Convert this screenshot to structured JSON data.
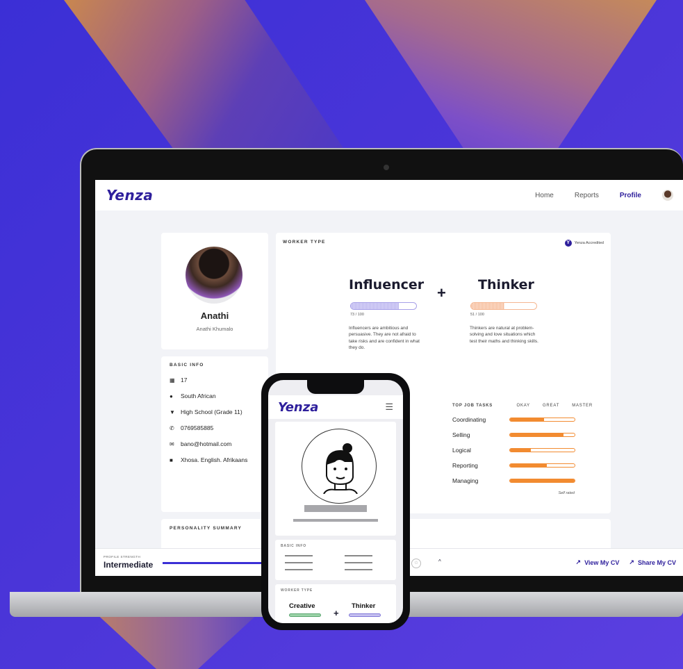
{
  "desktop": {
    "nav": {
      "logo": "Yenza",
      "links": [
        "Home",
        "Reports",
        "Profile"
      ]
    },
    "profile": {
      "name": "Anathi",
      "full_name": "Anathi Khumalo"
    },
    "basic_info": {
      "label": "BASIC INFO",
      "age": "17",
      "nationality": "South African",
      "education": "High School (Grade 11)",
      "phone": "0769585885",
      "email": "bano@hotmail.com",
      "languages": "Xhosa. English. Afrikaans"
    },
    "worker_type": {
      "label": "WORKER TYPE",
      "accredited": "Yenza Accredited",
      "primary": {
        "title": "Influencer",
        "score": "73 / 100",
        "score_value": 73,
        "description": "Influencers are ambitious and persuasive. They are not afraid to take risks and are confident in what they do."
      },
      "secondary": {
        "title": "Thinker",
        "score": "51 / 100",
        "score_value": 51,
        "description": "Thinkers are natural at problem-solving and love situations which test their maths and thinking skills."
      },
      "plus": "+"
    },
    "top_job_tasks": {
      "label": "TOP JOB TASKS",
      "levels": [
        "OKAY",
        "GREAT",
        "MASTER"
      ],
      "tasks": [
        {
          "name": "Coordinating",
          "level": 0.53
        },
        {
          "name": "Selling",
          "level": 0.83
        },
        {
          "name": "Logical",
          "level": 0.32
        },
        {
          "name": "Reporting",
          "level": 0.57
        },
        {
          "name": "Managing",
          "level": 1.0
        }
      ],
      "note": "Self rated"
    },
    "personality": {
      "label": "PERSONALITY SUMMARY"
    },
    "bottom_bar": {
      "strength_label": "PROFILE STRENGTH",
      "strength_value": "Intermediate",
      "view_cv": "View My CV",
      "share_cv": "Share My CV"
    }
  },
  "mobile": {
    "logo": "Yenza",
    "basic_info_label": "BASIC INFO",
    "worker_type_label": "WORKER TYPE",
    "primary": "Creative",
    "secondary": "Thinker",
    "plus": "+"
  },
  "colors": {
    "brand": "#2e1f9c",
    "accent_orange": "#f28b30",
    "background": "#4a35d8"
  }
}
